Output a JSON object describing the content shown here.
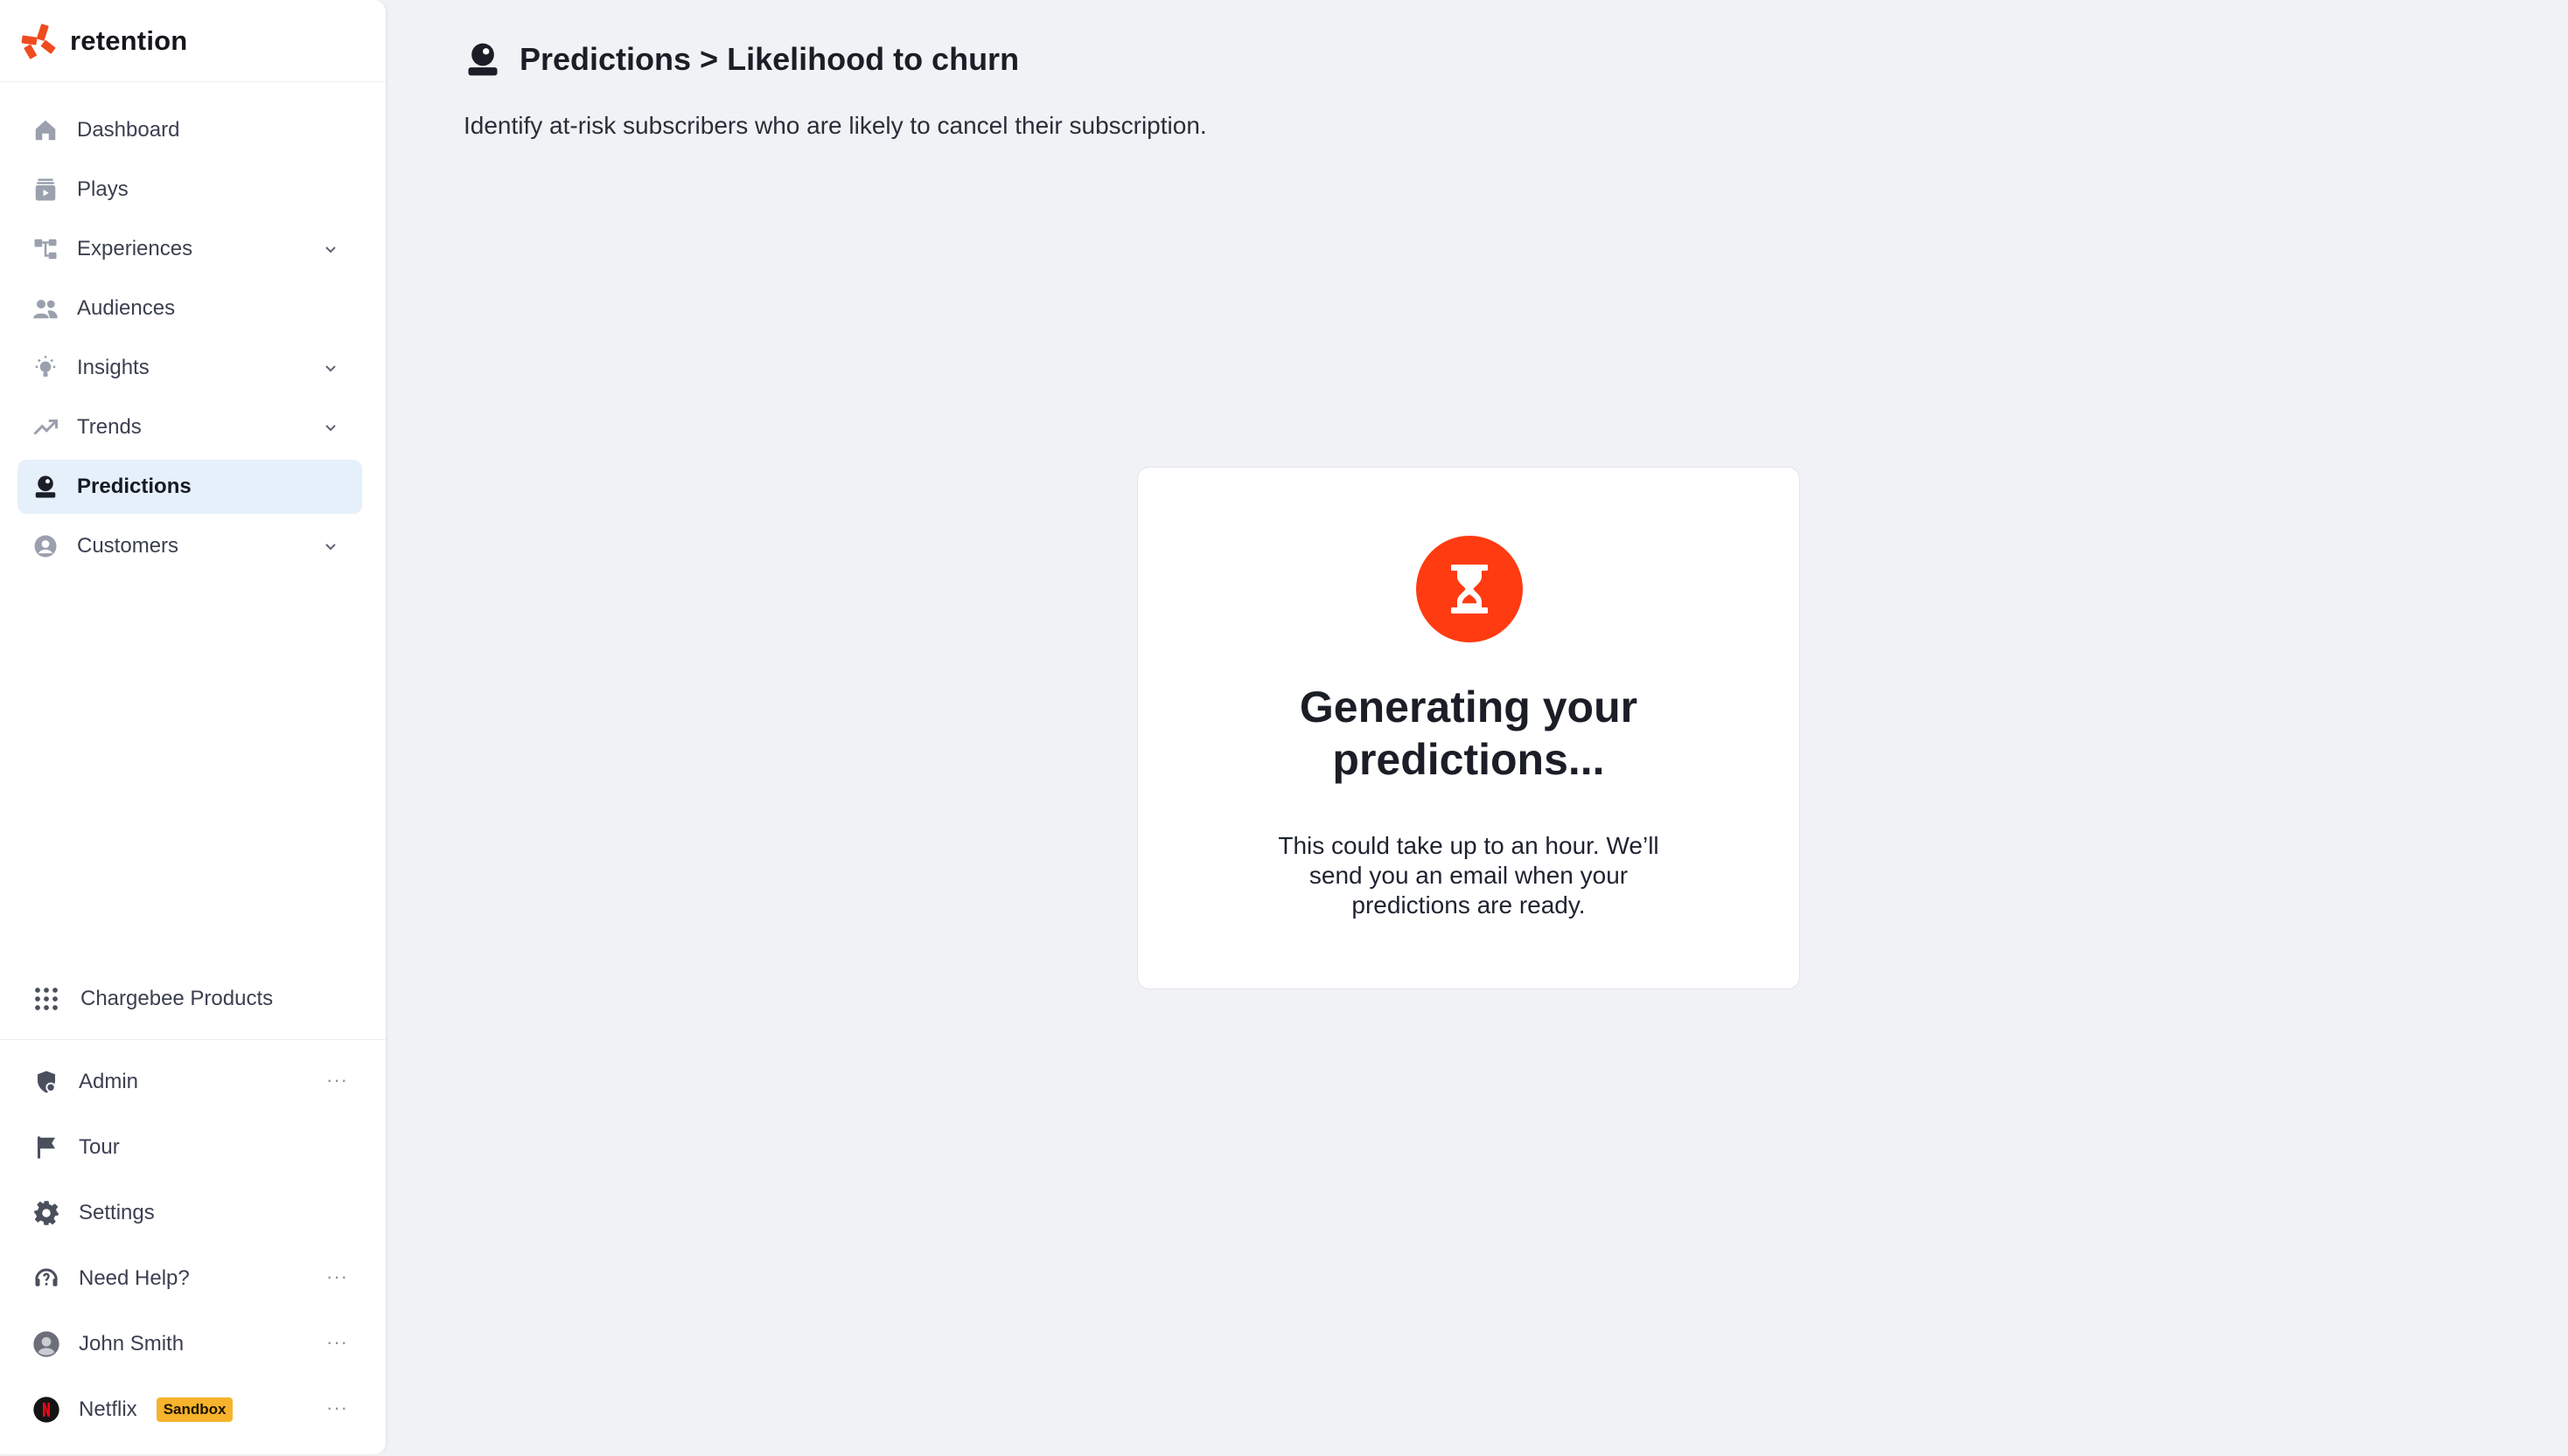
{
  "brand": {
    "name": "retention",
    "logo_icon": "chargebee-asterisk-icon",
    "accent": "#f04a1f"
  },
  "sidebar": {
    "items": [
      {
        "label": "Dashboard",
        "icon": "home-icon",
        "has_chevron": false
      },
      {
        "label": "Plays",
        "icon": "plays-icon",
        "has_chevron": false
      },
      {
        "label": "Experiences",
        "icon": "flow-icon",
        "has_chevron": true
      },
      {
        "label": "Audiences",
        "icon": "users-icon",
        "has_chevron": false
      },
      {
        "label": "Insights",
        "icon": "lightbulb-icon",
        "has_chevron": true
      },
      {
        "label": "Trends",
        "icon": "trend-up-icon",
        "has_chevron": true
      },
      {
        "label": "Predictions",
        "icon": "predictions-icon",
        "has_chevron": false,
        "active": true
      },
      {
        "label": "Customers",
        "icon": "user-circle-icon",
        "has_chevron": true
      }
    ],
    "products_label": "Chargebee Products",
    "bottom": {
      "admin": "Admin",
      "tour": "Tour",
      "settings": "Settings",
      "help": "Need Help?",
      "user": "John Smith",
      "account": "Netflix",
      "account_badge": "Sandbox",
      "more": "···"
    }
  },
  "header": {
    "title": "Predictions > Likelihood to churn",
    "subtitle": "Identify at-risk subscribers who are likely to cancel their subscription."
  },
  "card": {
    "icon": "hourglass-icon",
    "heading": "Generating your predictions...",
    "body": "This could take up to an hour. We’ll send you an email when your predictions are ready."
  },
  "colors": {
    "active_bg": "#e6f0fb",
    "hourglass_bg": "#ff3b12",
    "badge_bg": "#f6b32b"
  }
}
